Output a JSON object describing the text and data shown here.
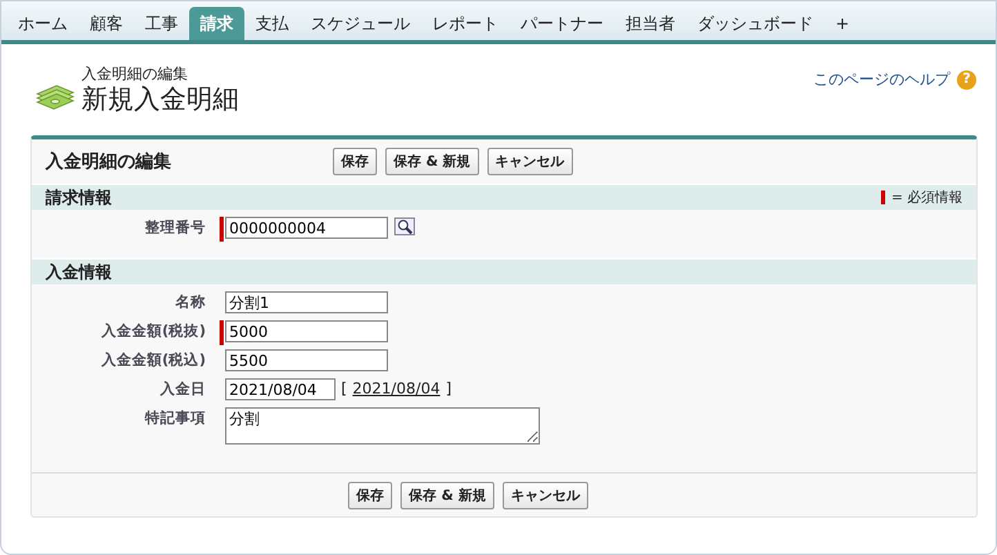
{
  "tabs": [
    {
      "label": "ホーム",
      "selected": false
    },
    {
      "label": "顧客",
      "selected": false
    },
    {
      "label": "工事",
      "selected": false
    },
    {
      "label": "請求",
      "selected": true
    },
    {
      "label": "支払",
      "selected": false
    },
    {
      "label": "スケジュール",
      "selected": false
    },
    {
      "label": "レポート",
      "selected": false
    },
    {
      "label": "パートナー",
      "selected": false
    },
    {
      "label": "担当者",
      "selected": false
    },
    {
      "label": "ダッシュボード",
      "selected": false
    },
    {
      "label": "+",
      "selected": false
    }
  ],
  "header": {
    "subtitle": "入金明細の編集",
    "title": "新規入金明細",
    "help": "このページのヘルプ",
    "help_icon": "?"
  },
  "block": {
    "title": "入金明細の編集",
    "buttons": [
      "保存",
      "保存 & 新規",
      "キャンセル"
    ],
    "required_legend": "= 必須情報",
    "sections": [
      {
        "title": "請求情報",
        "fields": [
          {
            "label": "整理番号",
            "value": "0000000004",
            "kind": "lookup",
            "required": true
          }
        ]
      },
      {
        "title": "入金情報",
        "fields": [
          {
            "label": "名称",
            "value": "分割1",
            "kind": "text",
            "required": false
          },
          {
            "label": "入金金額(税抜)",
            "value": "5000",
            "kind": "text",
            "required": true
          },
          {
            "label": "入金金額(税込)",
            "value": "5500",
            "kind": "text",
            "required": false
          },
          {
            "label": "入金日",
            "value": "2021/08/04",
            "kind": "date",
            "required": false,
            "today": "2021/08/04",
            "today_open": "[",
            "today_close": "]"
          },
          {
            "label": "特記事項",
            "value": "分割",
            "kind": "textarea",
            "required": false
          }
        ]
      }
    ],
    "bottom_buttons": [
      "保存",
      "保存 & 新規",
      "キャンセル"
    ]
  }
}
